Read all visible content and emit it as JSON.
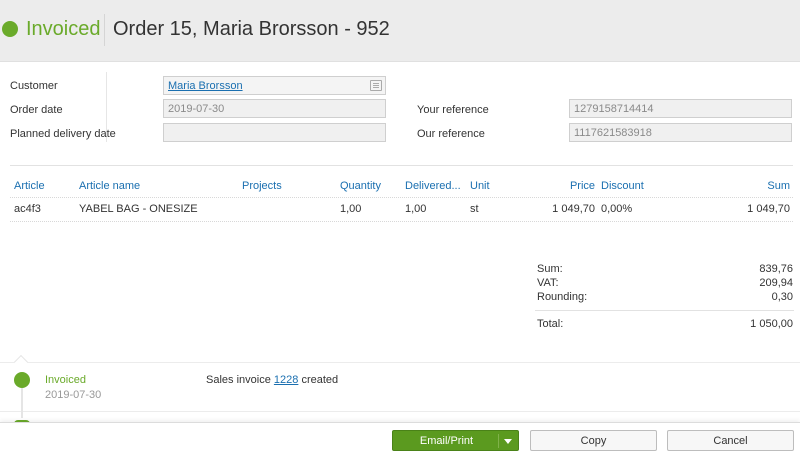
{
  "header": {
    "status": "Invoiced",
    "title": "Order 15, Maria Brorsson - 952",
    "status_color": "#6aaa2a"
  },
  "form": {
    "customer_label": "Customer",
    "customer_value": "Maria Brorsson",
    "order_date_label": "Order date",
    "order_date_value": "2019-07-30",
    "planned_delivery_label": "Planned delivery date",
    "planned_delivery_value": "",
    "your_reference_label": "Your reference",
    "your_reference_value": "1279158714414",
    "our_reference_label": "Our reference",
    "our_reference_value": "1117621583918"
  },
  "table": {
    "columns": [
      "Article",
      "Article name",
      "Projects",
      "Quantity",
      "Delivered...",
      "Unit",
      "Price",
      "Discount",
      "Sum"
    ],
    "rows": [
      {
        "article": "ac4f3",
        "article_name": "YABEL BAG - ONESIZE",
        "projects": "",
        "quantity": "1,00",
        "delivered": "1,00",
        "unit": "st",
        "price": "1 049,70",
        "discount": "0,00%",
        "sum": "1 049,70"
      }
    ]
  },
  "totals": {
    "sum_label": "Sum:",
    "sum_value": "839,76",
    "vat_label": "VAT:",
    "vat_value": "209,94",
    "rounding_label": "Rounding:",
    "rounding_value": "0,30",
    "total_label": "Total:",
    "total_value": "1 050,00"
  },
  "timeline": {
    "status": "Invoiced",
    "date": "2019-07-30",
    "message_prefix": "Sales invoice",
    "invoice_number": "1228",
    "message_suffix": "created"
  },
  "footer": {
    "email_print_label": "Email/Print",
    "copy_label": "Copy",
    "cancel_label": "Cancel"
  }
}
